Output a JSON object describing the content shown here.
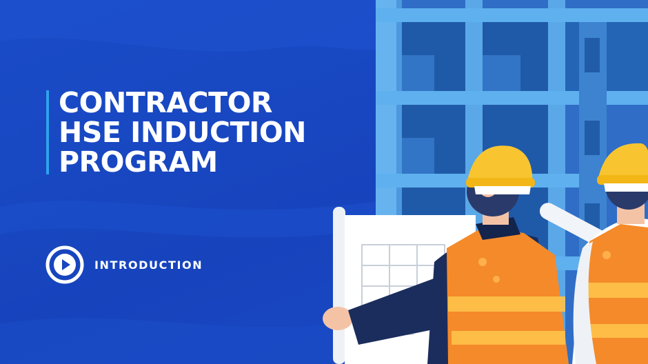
{
  "slide": {
    "title_lines": [
      "CONTRACTOR",
      "HSE INDUCTION",
      "PROGRAM"
    ],
    "section_label": "INTRODUCTION",
    "play_icon": "play-circle-icon",
    "illustration": "construction-workers-with-blueprint",
    "colors": {
      "background": "#1946c0",
      "accent_bar": "#2ea3ee",
      "text": "#ffffff",
      "building": "#5aa8e8",
      "helmet": "#f8c530",
      "vest": "#f58a2a"
    }
  }
}
